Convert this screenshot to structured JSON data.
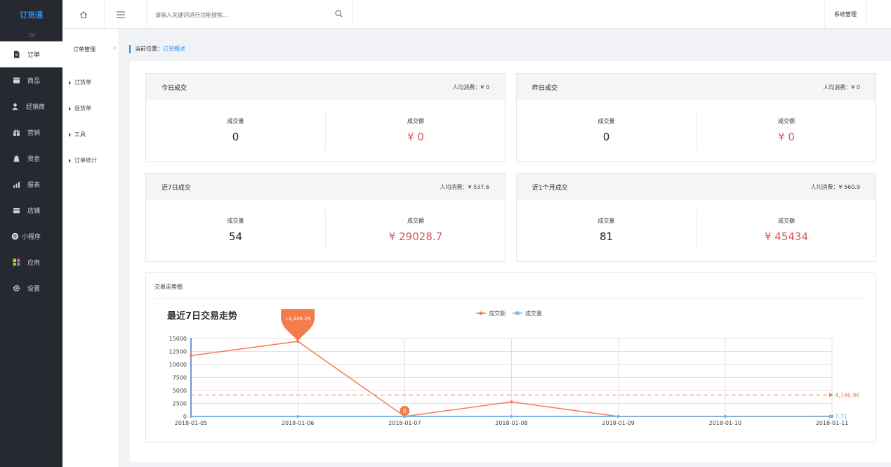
{
  "app": {
    "logo": "订货通"
  },
  "topbar": {
    "search_placeholder": "请输入关键词进行功能搜索...",
    "system_mgmt": "系统管理"
  },
  "sidebar": {
    "items": [
      {
        "label": "订单",
        "icon": "document-icon",
        "active": true
      },
      {
        "label": "商品",
        "icon": "box-icon"
      },
      {
        "label": "经销商",
        "icon": "user-icon"
      },
      {
        "label": "营销",
        "icon": "gift-icon"
      },
      {
        "label": "资金",
        "icon": "wallet-icon"
      },
      {
        "label": "报表",
        "icon": "bar-chart-icon"
      },
      {
        "label": "店铺",
        "icon": "store-icon"
      },
      {
        "label": "小程序",
        "icon": "mini-program-icon"
      },
      {
        "label": "应用",
        "icon": "apps-icon"
      },
      {
        "label": "设置",
        "icon": "gear-icon"
      }
    ]
  },
  "submenu": {
    "title": "订单管理",
    "items": [
      "订货单",
      "退货单",
      "工具",
      "订单统计"
    ]
  },
  "breadcrumb": {
    "prefix": "当前位置：",
    "current": "订单概述"
  },
  "cards": [
    {
      "title": "今日成交",
      "avg": "人均消费：¥ 0",
      "qty_label": "成交量",
      "qty": "0",
      "amt_label": "成交额",
      "amt": "¥ 0"
    },
    {
      "title": "昨日成交",
      "avg": "人均消费：¥ 0",
      "qty_label": "成交量",
      "qty": "0",
      "amt_label": "成交额",
      "amt": "¥ 0"
    },
    {
      "title": "近7日成交",
      "avg": "人均消费：¥ 537.6",
      "qty_label": "成交量",
      "qty": "54",
      "amt_label": "成交额",
      "amt": "¥ 29028.7"
    },
    {
      "title": "近1个月成交",
      "avg": "人均消费：¥ 560.9",
      "qty_label": "成交量",
      "qty": "81",
      "amt_label": "成交额",
      "amt": "¥ 45434"
    }
  ],
  "trend_section_title": "交易走势图",
  "chart_data": {
    "type": "line",
    "title": "最近7日交易走势",
    "categories": [
      "2018-01-05",
      "2018-01-06",
      "2018-01-07",
      "2018-01-08",
      "2018-01-09",
      "2018-01-10",
      "2018-01-11"
    ],
    "series": [
      {
        "name": "成交额",
        "color": "#f47c4b",
        "values": [
          11700,
          14448.28,
          0,
          2800,
          0,
          0,
          0
        ],
        "max_label": "14,448.28",
        "min_label": "0",
        "avg": 4146.96,
        "avg_label": "4,146.9€"
      },
      {
        "name": "成交量",
        "color": "#74b8e8",
        "values": [
          0,
          0,
          0,
          0,
          0,
          0,
          54
        ],
        "avg": 7.71,
        "avg_label": "7.71"
      }
    ],
    "yticks": [
      0,
      2500,
      5000,
      7500,
      10000,
      12500,
      15000
    ],
    "ylim": [
      0,
      15000
    ],
    "legend": "top-center",
    "grid": true
  }
}
